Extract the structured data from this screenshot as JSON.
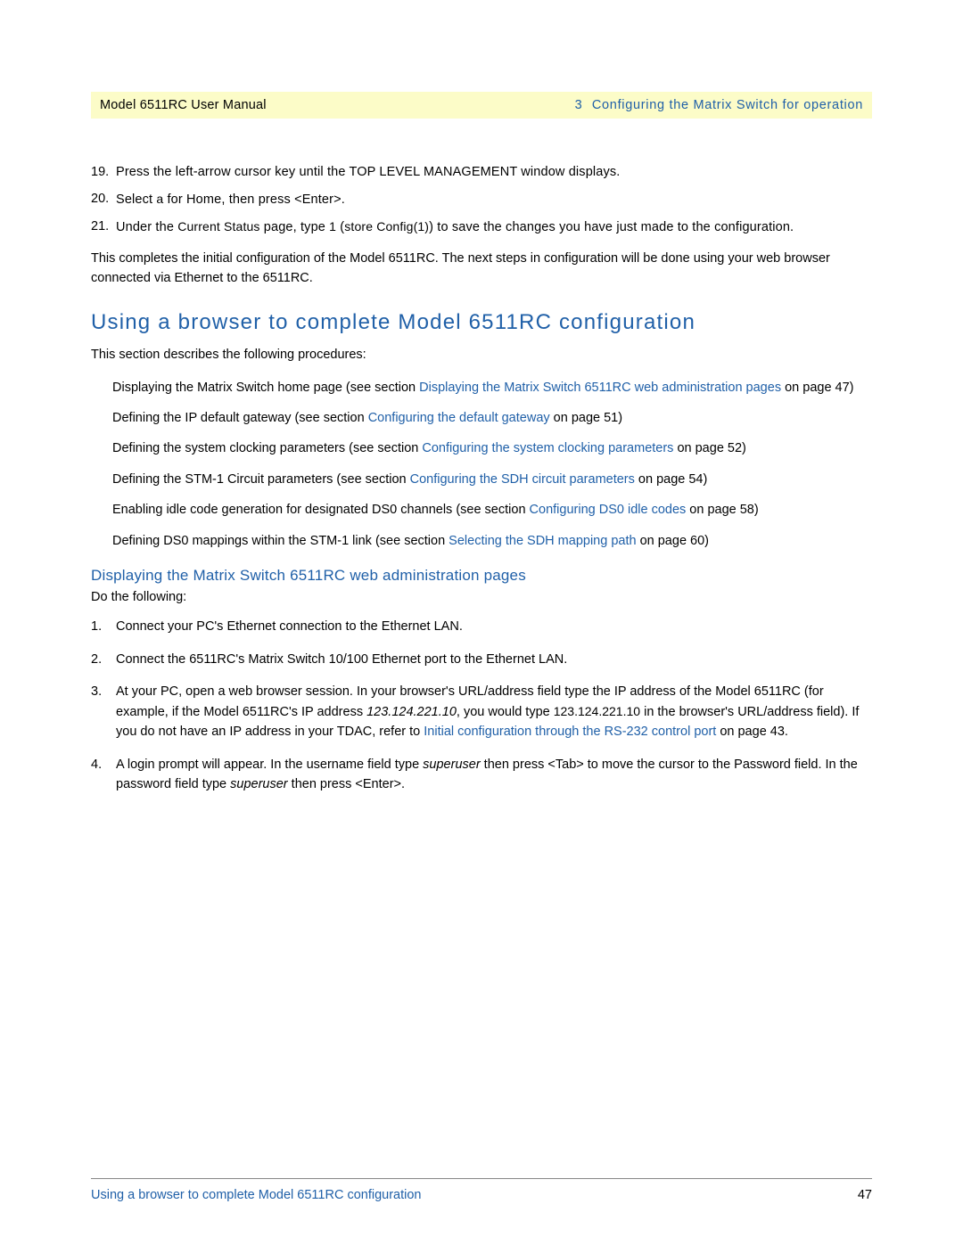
{
  "header": {
    "left": "Model 6511RC User Manual",
    "chapter_num": "3",
    "right": "Configuring the Matrix Switch for operation"
  },
  "steps_top": [
    {
      "num": "19.",
      "text": "Press the left-arrow cursor key until the TOP LEVEL MANAGEMENT window displays."
    },
    {
      "num": "20.",
      "text_a": "Select ",
      "code_a": "a",
      "text_b": " for Home, then press <Enter>."
    },
    {
      "num": "21.",
      "text_a": "Under the ",
      "code_a": "Current Status",
      "text_b": " page, type ",
      "code_b": "1",
      "text_c": " (",
      "code_c": "store Config(1)",
      "text_d": ") to save the changes you have just made to the configuration."
    }
  ],
  "completion_para": "This completes the initial configuration of the Model 6511RC. The next steps in configuration will be done using your web browser connected via Ethernet to the 6511RC.",
  "h1": "Using a browser to complete Model 6511RC configuration",
  "intro": "This section describes the following procedures:",
  "bullets": [
    {
      "pre": "Displaying the Matrix Switch home page (see section ",
      "link": "Displaying the Matrix Switch 6511RC web administration pages",
      "post": " on page 47)"
    },
    {
      "pre": "Defining the IP default gateway (see section ",
      "link": "Configuring the default gateway",
      "post": " on page 51)"
    },
    {
      "pre": "Defining the system clocking parameters (see section ",
      "link": "Configuring the system clocking parameters",
      "post": " on page 52)"
    },
    {
      "pre": "Defining the STM-1 Circuit parameters (see section ",
      "link": "Configuring the SDH circuit parameters",
      "post": " on page 54)"
    },
    {
      "pre": "Enabling idle code generation for designated DS0 channels (see section ",
      "link": "Configuring DS0 idle codes",
      "post": " on page 58)"
    },
    {
      "pre": "Defining DS0 mappings within the STM-1 link (see section ",
      "link": "Selecting the SDH mapping path",
      "post": " on page 60)"
    }
  ],
  "h2": "Displaying the Matrix Switch 6511RC web administration pages",
  "do_following": "Do the following:",
  "steps_num": [
    {
      "num": "1.",
      "text": "Connect your PC's Ethernet connection to the Ethernet LAN."
    },
    {
      "num": "2.",
      "text": "Connect the 6511RC's Matrix Switch 10/100 Ethernet port to the Ethernet LAN."
    },
    {
      "num": "3.",
      "pre": "At your PC, open a web browser session. In your browser's URL/address field type the IP address of the Model 6511RC (for example, if the Model 6511RC's IP address ",
      "ip1": "123.124.221.10",
      "mid": ", you would type ",
      "ip2": "123.124.221.10",
      "mid2": " in the browser's URL/address field). If you do not have an IP address in your TDAC, refer to ",
      "link": "Initial configuration through the RS-232 control port",
      "post": " on page 43."
    },
    {
      "num": "4.",
      "pre": "A login prompt will appear. In the username field type ",
      "val1": "superuser",
      "mid": " then press <Tab> to move the cursor to the Password field. In the password field type ",
      "val2": "superuser",
      "post": " then press <Enter>."
    }
  ],
  "footer": {
    "left": "Using a browser to complete Model 6511RC configuration",
    "page": "47"
  }
}
